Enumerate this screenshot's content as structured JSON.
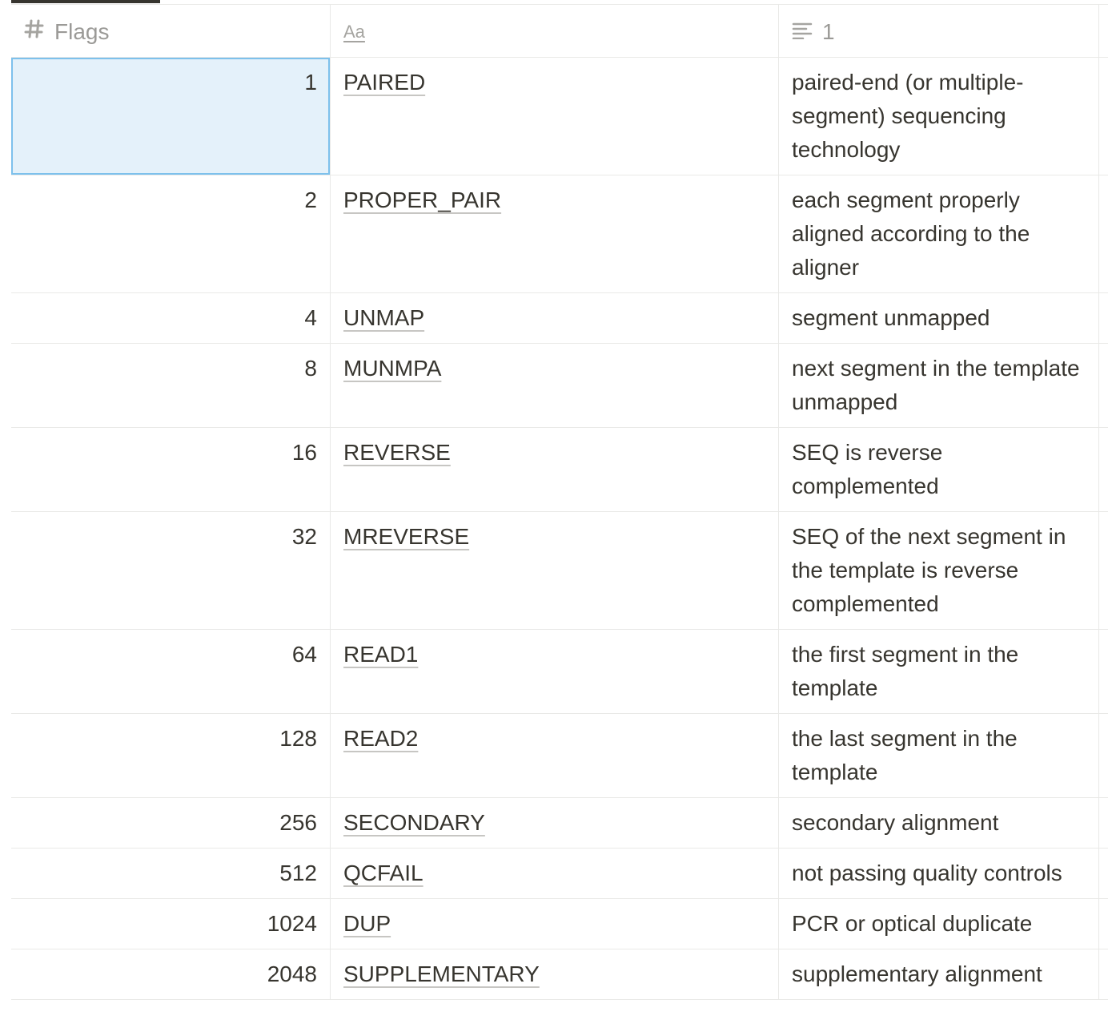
{
  "header": {
    "col1_label": "Flags",
    "col1_icon": "number-icon",
    "col2_icon_label": "Aa",
    "col3_label": "1",
    "col3_icon": "text-lines-icon"
  },
  "rows": [
    {
      "value": "1",
      "name": "PAIRED",
      "desc": "paired-end (or multiple-segment) sequencing technology"
    },
    {
      "value": "2",
      "name": "PROPER_PAIR",
      "desc": "each segment properly aligned according to the aligner"
    },
    {
      "value": "4",
      "name": "UNMAP",
      "desc": "segment unmapped"
    },
    {
      "value": "8",
      "name": "MUNMPA",
      "desc": "next segment in the template unmapped"
    },
    {
      "value": "16",
      "name": "REVERSE",
      "desc": "SEQ is reverse complemented"
    },
    {
      "value": "32",
      "name": "MREVERSE",
      "desc": "SEQ of the next segment in the template is reverse complemented"
    },
    {
      "value": "64",
      "name": "READ1",
      "desc": "the first segment in the template"
    },
    {
      "value": "128",
      "name": "READ2",
      "desc": "the last segment in the template"
    },
    {
      "value": "256",
      "name": "SECONDARY",
      "desc": "secondary alignment"
    },
    {
      "value": "512",
      "name": "QCFAIL",
      "desc": "not passing quality controls"
    },
    {
      "value": "1024",
      "name": "DUP",
      "desc": "PCR or optical duplicate"
    },
    {
      "value": "2048",
      "name": "SUPPLEMENTARY",
      "desc": "supplementary alignment"
    }
  ],
  "colors": {
    "selection_bg": "#e4f1fa",
    "selection_border": "#7dc1ec",
    "grid": "#e9e9e7",
    "text": "#37352f",
    "muted": "#9b9a97"
  }
}
